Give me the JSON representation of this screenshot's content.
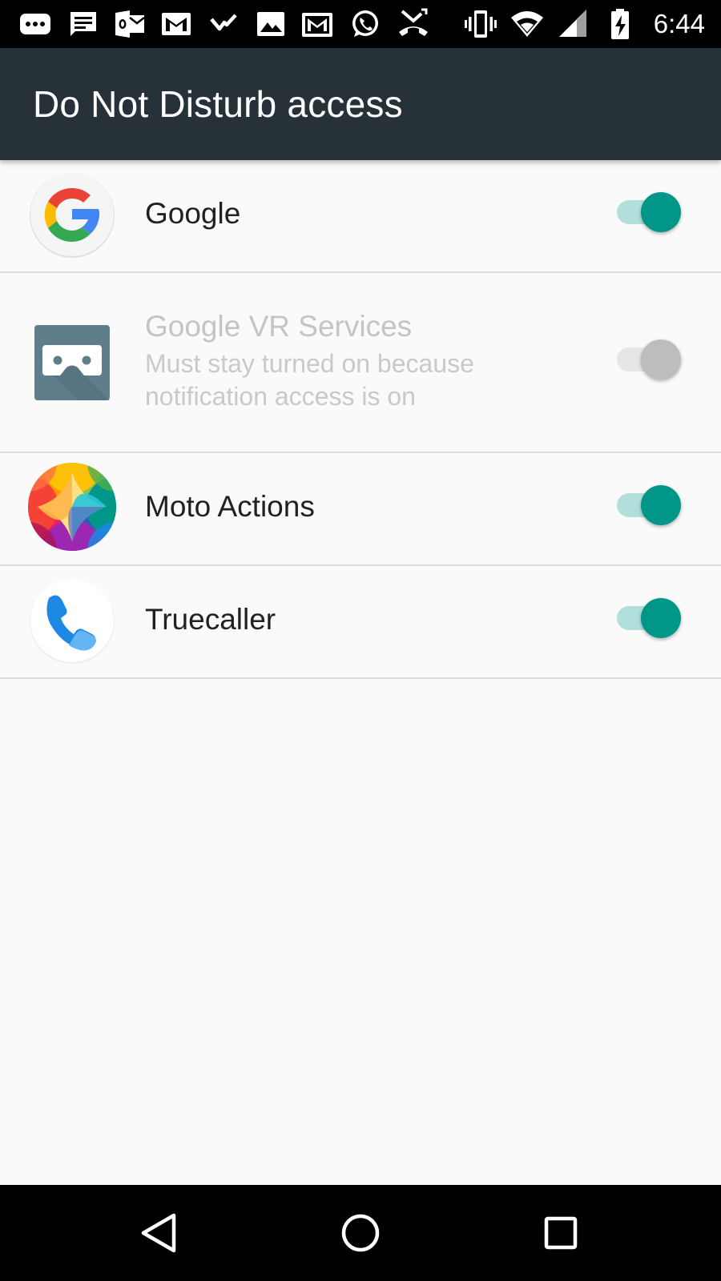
{
  "status_bar": {
    "time": "6:44",
    "icons": [
      "chat-bubble-icon",
      "message-icon",
      "outlook-icon",
      "gmail-icon",
      "checkmark-icon",
      "image-icon",
      "gmail-icon",
      "whatsapp-icon",
      "missed-call-icon",
      "vibrate-icon",
      "wifi-icon",
      "signal-icon",
      "battery-charging-icon"
    ]
  },
  "toolbar": {
    "title": "Do Not Disturb access"
  },
  "apps": [
    {
      "name": "Google",
      "icon": "google-icon",
      "enabled": true,
      "disabled": false
    },
    {
      "name": "Google VR Services",
      "subtitle": "Must stay turned on because notification access is on",
      "icon": "google-vr-icon",
      "enabled": true,
      "disabled": true
    },
    {
      "name": "Moto Actions",
      "icon": "moto-actions-icon",
      "enabled": true,
      "disabled": false
    },
    {
      "name": "Truecaller",
      "icon": "truecaller-icon",
      "enabled": true,
      "disabled": false
    }
  ],
  "nav_bar": {
    "buttons": [
      "back-icon",
      "home-icon",
      "recents-icon"
    ]
  },
  "colors": {
    "toolbar": "#263238",
    "accent": "#009688",
    "accent_track": "#b2dfdb",
    "status_bar": "#000000",
    "background": "#fafafa"
  }
}
